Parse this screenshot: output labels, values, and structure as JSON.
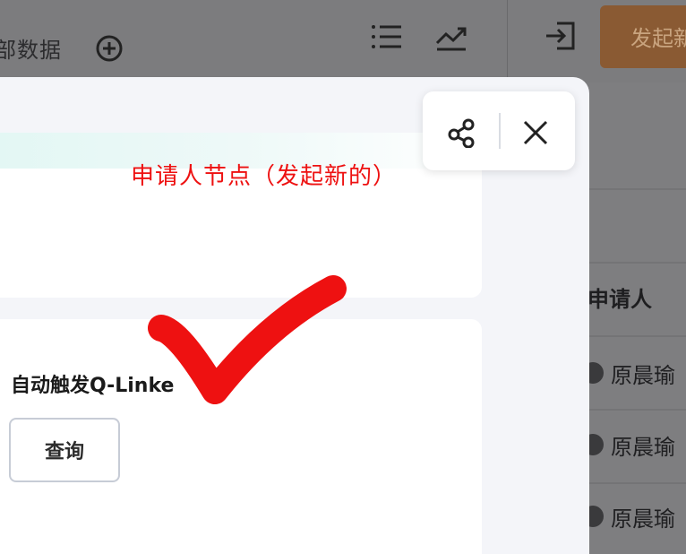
{
  "header": {
    "tab_text": "部数据",
    "start_button": "发起新",
    "icons": [
      "plus-circle-icon",
      "list-icon",
      "trend-icon",
      "login-icon"
    ]
  },
  "table": {
    "column_header": "申请人",
    "rows": [
      {
        "name": "原晨瑜"
      },
      {
        "name": "原晨瑜"
      },
      {
        "name": "原晨瑜"
      }
    ]
  },
  "drawer": {
    "auto_trigger_label": "自动触发Q-Linke",
    "query_button": "查询",
    "actions": [
      "share-icon",
      "close-icon"
    ]
  },
  "annotation": {
    "text": "申请人节点（发起新的）",
    "color": "#ee1111"
  },
  "colors": {
    "accent_orange": "#8a5a33",
    "annotation_red": "#ee1111"
  }
}
